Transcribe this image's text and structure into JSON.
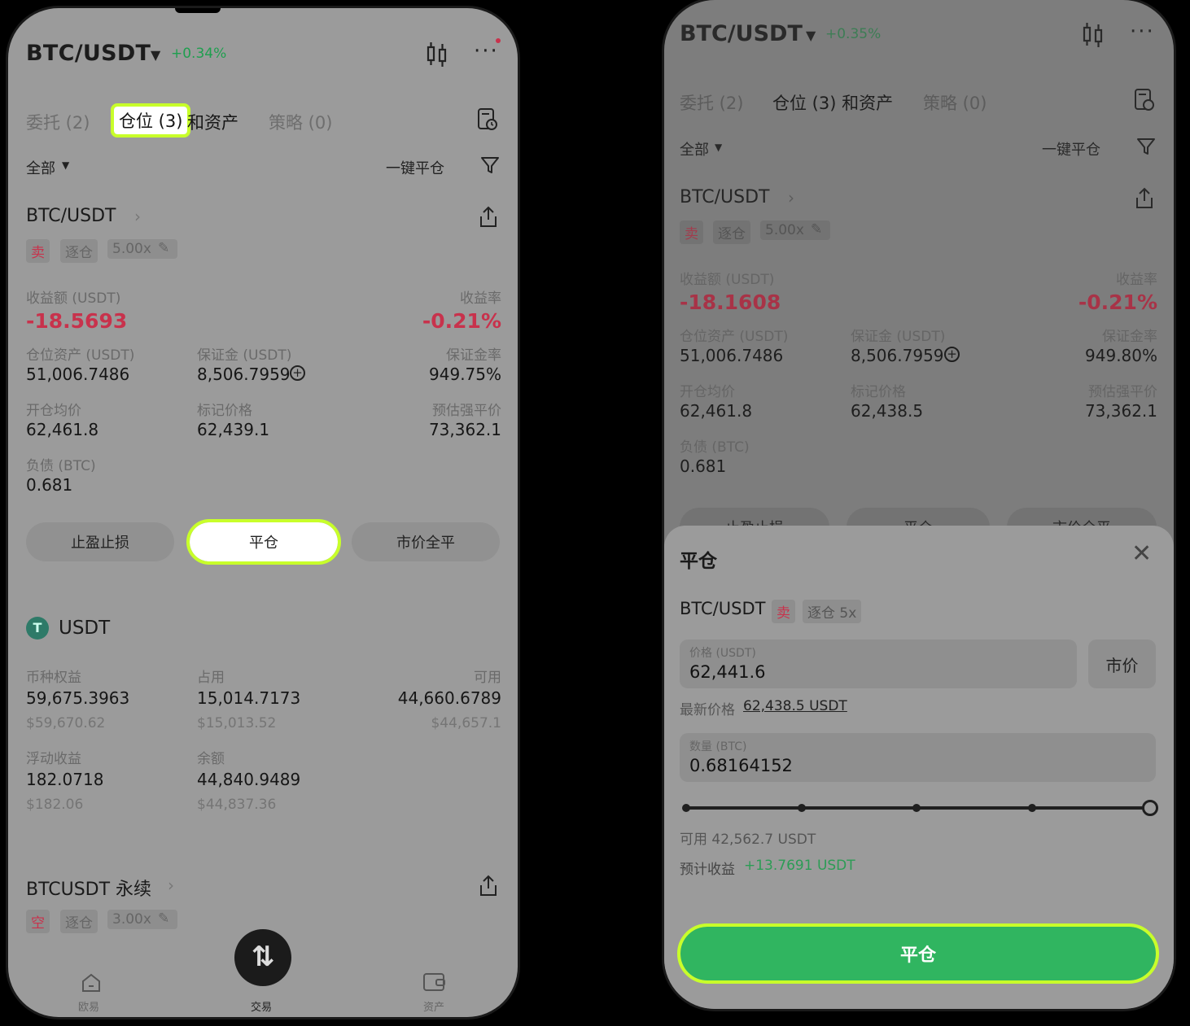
{
  "left": {
    "header": {
      "pair": "BTC/USDT",
      "change": "+0.34%"
    },
    "tabs": [
      {
        "label": "委托 (2)"
      },
      {
        "label": "仓位 (3)"
      },
      {
        "label": "和资产"
      },
      {
        "label": "策略 (0)"
      }
    ],
    "filter": {
      "all": "全部",
      "close_all": "一键平仓"
    },
    "position": {
      "pair": "BTC/USDT",
      "tags": [
        "卖",
        "逐仓",
        "5.00x"
      ],
      "pnl_label": "收益额 (USDT)",
      "pnl_value": "-18.5693",
      "roi_label": "收益率",
      "roi_value": "-0.21%",
      "assets_label": "仓位资产 (USDT)",
      "assets_value": "51,006.7486",
      "margin_label": "保证金 (USDT)",
      "margin_value": "8,506.7959",
      "margin_rate_label": "保证金率",
      "margin_rate_value": "949.75%",
      "open_label": "开仓均价",
      "open_value": "62,461.8",
      "mark_label": "标记价格",
      "mark_value": "62,439.1",
      "liq_label": "预估强平价",
      "liq_value": "73,362.1",
      "debt_label": "负债 (BTC)",
      "debt_value": "0.681"
    },
    "actions": {
      "tpsl": "止盈止损",
      "close": "平仓",
      "market_close": "市价全平"
    },
    "usdt": {
      "name": "USDT",
      "equity_label": "币种权益",
      "equity_value": "59,675.3963",
      "equity_usd": "$59,670.62",
      "occupied_label": "占用",
      "occupied_value": "15,014.7173",
      "occupied_usd": "$15,013.52",
      "available_label": "可用",
      "available_value": "44,660.6789",
      "available_usd": "$44,657.1",
      "float_label": "浮动收益",
      "float_value": "182.0718",
      "float_usd": "$182.06",
      "balance_label": "余额",
      "balance_value": "44,840.9489",
      "balance_usd": "$44,837.36"
    },
    "perp": {
      "pair": "BTCUSDT 永续",
      "tags": [
        "空",
        "逐仓",
        "3.00x"
      ]
    },
    "nav": {
      "home": "欧易",
      "trade": "交易",
      "assets": "资产"
    }
  },
  "right": {
    "header": {
      "pair": "BTC/USDT",
      "change": "+0.35%"
    },
    "tabs": [
      {
        "label": "委托 (2)"
      },
      {
        "label": "仓位 (3) 和资产"
      },
      {
        "label": "策略 (0)"
      }
    ],
    "filter": {
      "all": "全部",
      "close_all": "一键平仓"
    },
    "position": {
      "pair": "BTC/USDT",
      "tags": [
        "卖",
        "逐仓",
        "5.00x"
      ],
      "pnl_label": "收益额 (USDT)",
      "pnl_value": "-18.1608",
      "roi_label": "收益率",
      "roi_value": "-0.21%",
      "assets_label": "仓位资产 (USDT)",
      "assets_value": "51,006.7486",
      "margin_label": "保证金 (USDT)",
      "margin_value": "8,506.7959",
      "margin_rate_label": "保证金率",
      "margin_rate_value": "949.80%",
      "open_label": "开仓均价",
      "open_value": "62,461.8",
      "mark_label": "标记价格",
      "mark_value": "62,438.5",
      "liq_label": "预估强平价",
      "liq_value": "73,362.1",
      "debt_label": "负债 (BTC)",
      "debt_value": "0.681"
    },
    "actions": {
      "tpsl": "止盈止损",
      "close": "平仓",
      "market_close": "市价全平"
    },
    "sheet": {
      "title": "平仓",
      "pair": "BTC/USDT",
      "side": "卖",
      "mode": "逐仓 5x",
      "price_label": "价格 (USDT)",
      "price_value": "62,441.6",
      "market_btn": "市价",
      "latest_label": "最新价格",
      "latest_value": "62,438.5 USDT",
      "qty_label": "数量 (BTC)",
      "qty_value": "0.68164152",
      "slider_fraction": 1.0,
      "available": "可用 42,562.7 USDT",
      "est_label": "预计收益",
      "est_value": "+13.7691 USDT",
      "confirm": "平仓"
    }
  },
  "colors": {
    "accent_green": "#30b560",
    "highlight": "#c8ff2a",
    "loss_red": "#c8324c"
  }
}
